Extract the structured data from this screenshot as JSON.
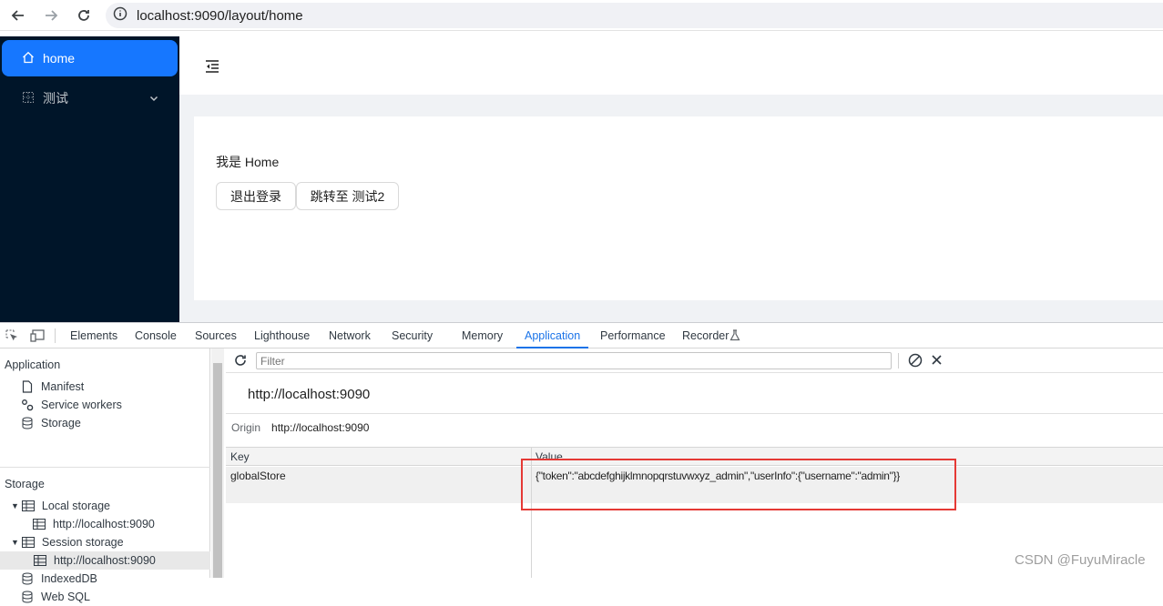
{
  "browser": {
    "url": "localhost:9090/layout/home",
    "icons": [
      "back-arrow-icon",
      "forward-arrow-icon",
      "reload-icon",
      "site-info-icon"
    ]
  },
  "sidebar": {
    "items": [
      {
        "label": "home",
        "icon": "home-icon",
        "active": true
      },
      {
        "label": "测试",
        "icon": "grid-icon",
        "expandable": true
      }
    ]
  },
  "content": {
    "greeting": "我是 Home",
    "logout_label": "退出登录",
    "goto_label": "跳转至 测试2"
  },
  "devtools": {
    "tabs": [
      "Elements",
      "Console",
      "Sources",
      "Lighthouse",
      "Network",
      "Security",
      "Memory",
      "Application",
      "Performance",
      "Recorder"
    ],
    "active_tab": "Application",
    "sidebar": {
      "application_title": "Application",
      "application_items": [
        "Manifest",
        "Service workers",
        "Storage"
      ],
      "storage_title": "Storage",
      "local_storage": "Local storage",
      "local_origin": "http://localhost:9090",
      "session_storage": "Session storage",
      "session_origin": "http://localhost:9090",
      "indexeddb": "IndexedDB",
      "websql": "Web SQL"
    },
    "main": {
      "filter_placeholder": "Filter",
      "origin_heading": "http://localhost:9090",
      "origin_label": "Origin",
      "origin_value": "http://localhost:9090",
      "columns": [
        "Key",
        "Value"
      ],
      "rows": [
        {
          "key": "globalStore",
          "value": "{\"token\":\"abcdefghijklmnopqrstuvwxyz_admin\",\"userInfo\":{\"username\":\"admin\"}}"
        }
      ]
    }
  },
  "watermark": "CSDN @FuyuMiracle",
  "colors": {
    "sidebar_bg": "#001529",
    "menu_active": "#1677ff",
    "devtools_accent": "#1a73e8",
    "highlight_box": "#e53935"
  }
}
